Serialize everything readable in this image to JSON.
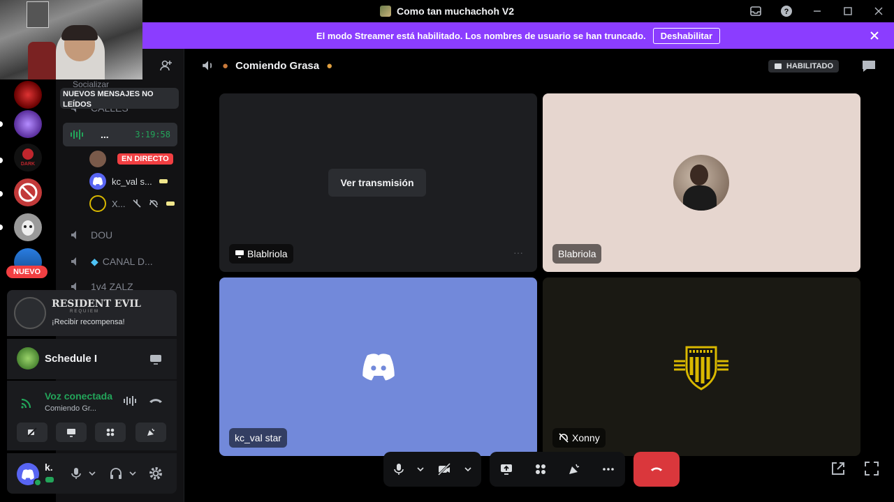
{
  "window": {
    "title": "Como tan muchachoh V2"
  },
  "banner": {
    "message": "El modo Streamer está habilitado. Los nombres de usuario se han truncado.",
    "button": "Deshabilitar"
  },
  "rail": {
    "new_badge": "NUEVO"
  },
  "sidebar": {
    "category": "Socializar",
    "new_messages": "NUEVOS MENSAJES NO LEÍDOS",
    "channels": [
      {
        "label": "CALLES"
      },
      {
        "label": "...",
        "timer": "3:19:58"
      },
      {
        "label": "DOU"
      },
      {
        "label": "CANAL D..."
      },
      {
        "label": "1v4 ZALZ"
      }
    ],
    "members": [
      {
        "name": "",
        "badge": "EN DIRECTO"
      },
      {
        "name": "kc_val s..."
      },
      {
        "name": "X..."
      }
    ]
  },
  "promo": {
    "game": "RESIDENT EVIL",
    "subtitle": "REQUIEM",
    "reward": "¡Recibir recompensa!"
  },
  "activity": {
    "name": "Schedule I"
  },
  "voice": {
    "status": "Voz conectada",
    "channel": "Comiendo Gr..."
  },
  "user": {
    "name": "k."
  },
  "channel": {
    "name": "Comiendo Grasa",
    "stream_badge": "HABILITADO"
  },
  "tiles": [
    {
      "label": "Blablriola",
      "action": "Ver transmisión"
    },
    {
      "label": "Blabriola"
    },
    {
      "label": "kc_val star"
    },
    {
      "label": "Xonny"
    }
  ],
  "colors": {
    "accent": "#8b3dff",
    "discord_blurple": "#7289da",
    "live_red": "#f23f42",
    "connected_green": "#23a55a"
  }
}
